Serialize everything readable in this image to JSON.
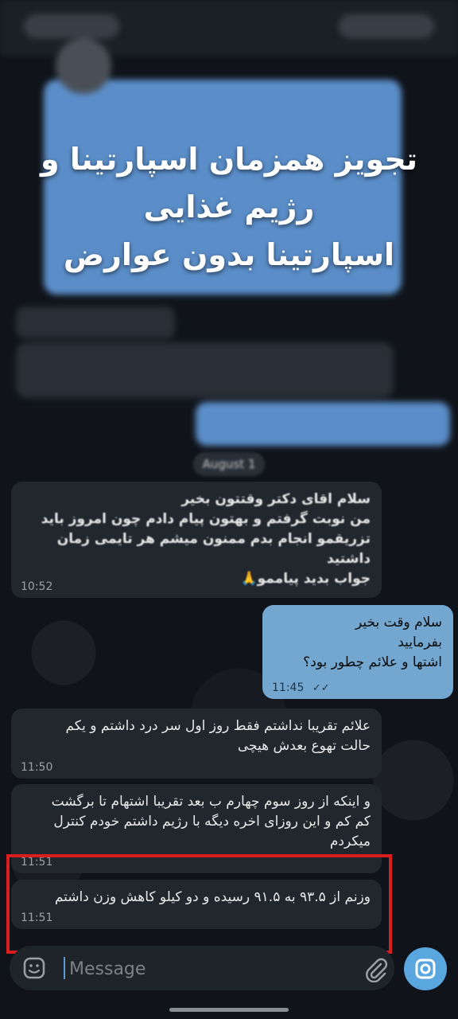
{
  "overlay": {
    "line1": "تجویز همزمان اسپارتینا و",
    "line2": "رژیم غذایی",
    "line3": "اسپارتینا بدون عوارض"
  },
  "date_separator": "August 1",
  "messages": [
    {
      "direction": "incoming",
      "text": "سلام اقای دکتر وقتتون بخیر\nمن نوبت گرفتم و بهتون پیام دادم چون امروز باید\nتزریقمو انجام بدم ممنون میشم هر تایمی زمان داشتید\nجواب بدید پیاممو🙏",
      "time": "10:52"
    },
    {
      "direction": "outgoing",
      "text": "سلام وقت بخیر\nبفرمایید\nاشتها و علائم چطور بود؟",
      "time": "11:45"
    },
    {
      "direction": "incoming",
      "text": "علائم تقریبا نداشتم فقط روز اول سر درد داشتم و یکم\nحالت تهوع بعدش هیچی",
      "time": "11:50"
    },
    {
      "direction": "incoming",
      "text": "و اینکه از روز سوم چهارم ب بعد تقریبا اشتهام تا برگشت\nکم کم و این روزای اخره دیگه با رژیم داشتم خودم کنترل\nمیکردم",
      "time": "11:51"
    },
    {
      "direction": "incoming",
      "text": "وزنم از ۹۳.۵ به ۹۱.۵ رسیده و دو کیلو کاهش وزن داشتم",
      "time": "11:51"
    }
  ],
  "composer": {
    "placeholder": "Message"
  },
  "colors": {
    "outgoing_bubble": "#73a7cf",
    "incoming_bubble": "#22272e",
    "highlight_border": "#d81e1e",
    "camera_button": "#5aa7e0"
  },
  "icons": [
    "emoji-icon",
    "attach-icon",
    "camera-icon",
    "read-ticks-icon"
  ]
}
